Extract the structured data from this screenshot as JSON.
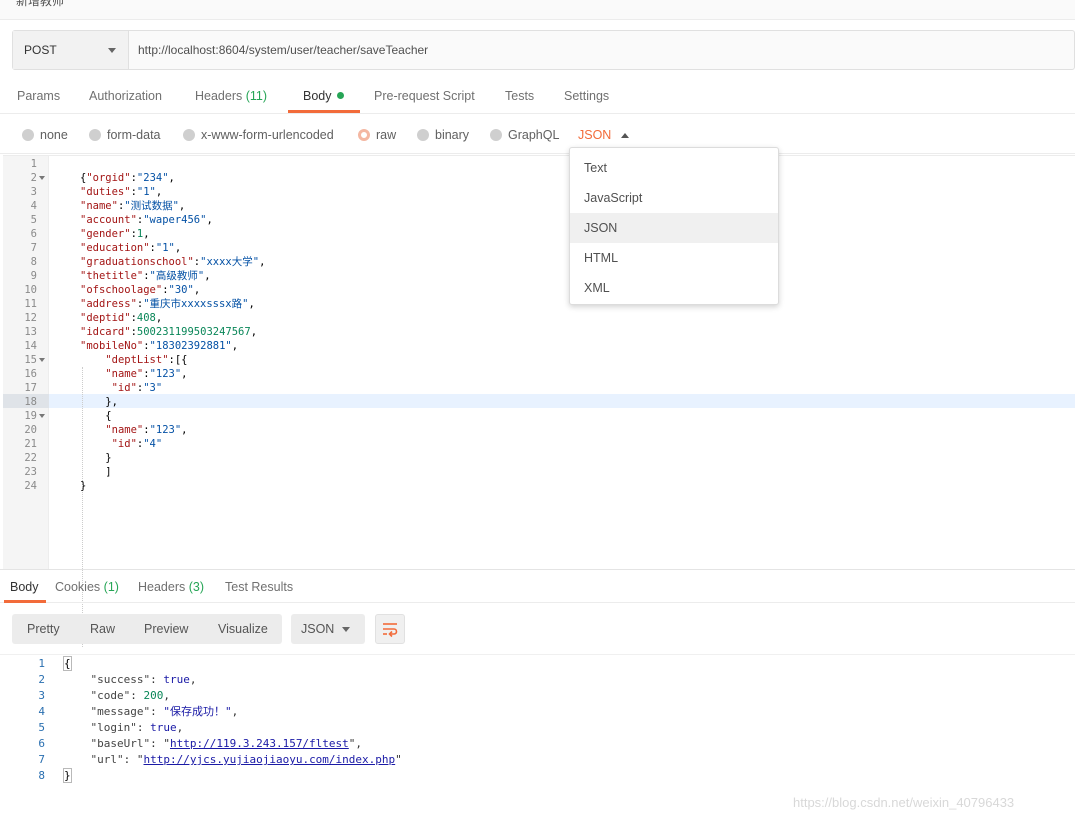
{
  "header": {
    "title": "新增教师"
  },
  "request": {
    "method": "POST",
    "url": "http://localhost:8604/system/user/teacher/saveTeacher"
  },
  "req_tabs": {
    "params": "Params",
    "authorization": "Authorization",
    "headers": "Headers",
    "headers_count": "(11)",
    "body": "Body",
    "prerequest": "Pre-request Script",
    "tests": "Tests",
    "settings": "Settings"
  },
  "body_types": {
    "none": "none",
    "form_data": "form-data",
    "urlencoded": "x-www-form-urlencoded",
    "raw": "raw",
    "binary": "binary",
    "graphql": "GraphQL",
    "selected_format": "JSON"
  },
  "format_menu": [
    "Text",
    "JavaScript",
    "JSON",
    "HTML",
    "XML"
  ],
  "editor": {
    "line_numbers": [
      "1",
      "2",
      "3",
      "4",
      "5",
      "6",
      "7",
      "8",
      "9",
      "10",
      "11",
      "12",
      "13",
      "14",
      "15",
      "16",
      "17",
      "18",
      "19",
      "20",
      "21",
      "22",
      "23",
      "24"
    ],
    "lines": [
      "",
      "{\"orgid\":\"234\",",
      "\"duties\":\"1\",",
      "\"name\":\"测试数据\",",
      "\"account\":\"waper456\",",
      "\"gender\":1,",
      "\"education\":\"1\",",
      "\"graduationschool\":\"xxxx大学\",",
      "\"thetitle\":\"高级教师\",",
      "\"ofschoolage\":\"30\",",
      "\"address\":\"重庆市xxxxsssx路\",",
      "\"deptid\":408,",
      "\"idcard\":500231199503247567,",
      "\"mobileNo\":\"18302392881\",",
      "    \"deptList\":[{",
      "    \"name\":\"123\",",
      "     \"id\":\"3\"",
      "    },",
      "    {",
      "    \"name\":\"123\",",
      "     \"id\":\"4\"",
      "    }",
      "    ]",
      "}"
    ]
  },
  "resp_tabs": {
    "body": "Body",
    "cookies": "Cookies",
    "cookies_count": "(1)",
    "headers": "Headers",
    "headers_count": "(3)",
    "test_results": "Test Results"
  },
  "view_modes": {
    "pretty": "Pretty",
    "raw": "Raw",
    "preview": "Preview",
    "visualize": "Visualize",
    "language": "JSON"
  },
  "response": {
    "line_numbers": [
      "1",
      "2",
      "3",
      "4",
      "5",
      "6",
      "7",
      "8"
    ],
    "open_brace": "{",
    "close_brace": "}",
    "fields": [
      {
        "key": "\"success\"",
        "value": "true",
        "kind": "bool"
      },
      {
        "key": "\"code\"",
        "value": "200",
        "kind": "num"
      },
      {
        "key": "\"message\"",
        "value": "\"保存成功！\"",
        "kind": "str"
      },
      {
        "key": "\"login\"",
        "value": "true",
        "kind": "bool"
      },
      {
        "key": "\"baseUrl\"",
        "value": "http://119.3.243.157/fltest",
        "kind": "url"
      },
      {
        "key": "\"url\"",
        "value": "http://yjcs.yujiaojiaoyu.com/index.php",
        "kind": "url"
      }
    ]
  },
  "watermark": "https://blog.csdn.net/weixin_40796433",
  "colors": {
    "accent": "#f26b3a",
    "count_green": "#26a556",
    "json_key": "#a31515",
    "json_string": "#0451a5",
    "json_number": "#098658"
  }
}
